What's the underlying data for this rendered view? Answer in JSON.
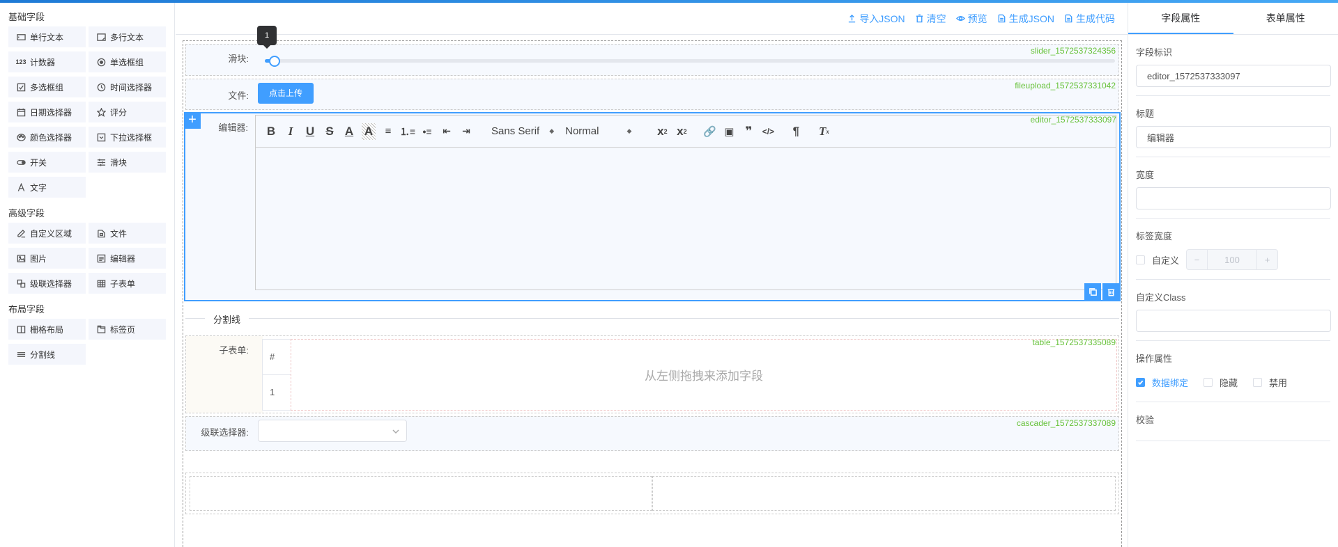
{
  "left_panel": {
    "groups": [
      {
        "title": "基础字段",
        "items": [
          {
            "label": "单行文本",
            "icon": "input-icon"
          },
          {
            "label": "多行文本",
            "icon": "textarea-icon"
          },
          {
            "label": "计数器",
            "icon": "number-icon"
          },
          {
            "label": "单选框组",
            "icon": "radio-icon"
          },
          {
            "label": "多选框组",
            "icon": "checkbox-icon"
          },
          {
            "label": "时间选择器",
            "icon": "clock-icon"
          },
          {
            "label": "日期选择器",
            "icon": "calendar-icon"
          },
          {
            "label": "评分",
            "icon": "star-icon"
          },
          {
            "label": "颜色选择器",
            "icon": "palette-icon"
          },
          {
            "label": "下拉选择框",
            "icon": "select-icon"
          },
          {
            "label": "开关",
            "icon": "switch-icon"
          },
          {
            "label": "滑块",
            "icon": "slider-icon"
          },
          {
            "label": "文字",
            "icon": "text-icon"
          }
        ]
      },
      {
        "title": "高级字段",
        "items": [
          {
            "label": "自定义区域",
            "icon": "pen-icon"
          },
          {
            "label": "文件",
            "icon": "file-icon"
          },
          {
            "label": "图片",
            "icon": "image-icon"
          },
          {
            "label": "编辑器",
            "icon": "editor-icon"
          },
          {
            "label": "级联选择器",
            "icon": "cascader-icon"
          },
          {
            "label": "子表单",
            "icon": "table-icon"
          }
        ]
      },
      {
        "title": "布局字段",
        "items": [
          {
            "label": "栅格布局",
            "icon": "grid-icon"
          },
          {
            "label": "标签页",
            "icon": "tabs-icon"
          },
          {
            "label": "分割线",
            "icon": "divider-icon"
          }
        ]
      }
    ]
  },
  "toolbar": {
    "import_json": "导入JSON",
    "clear": "清空",
    "preview": "预览",
    "gen_json": "生成JSON",
    "gen_code": "生成代码"
  },
  "canvas": {
    "slider": {
      "label": "滑块:",
      "key": "slider_1572537324356",
      "tooltip": "1",
      "value_fraction": 0.008
    },
    "file": {
      "label": "文件:",
      "key": "fileupload_1572537331042",
      "button": "点击上传"
    },
    "editor": {
      "label": "编辑器:",
      "key": "editor_1572537333097",
      "font": "Sans Serif",
      "size": "Normal"
    },
    "divider": {
      "text": "分割线"
    },
    "subtable": {
      "label": "子表单:",
      "key": "table_1572537335089",
      "col_header": "#",
      "row_index": "1",
      "placeholder": "从左侧拖拽来添加字段"
    },
    "cascader": {
      "label": "级联选择器:",
      "key": "cascader_1572537337089",
      "value": ""
    }
  },
  "right_panel": {
    "tabs": [
      "字段属性",
      "表单属性"
    ],
    "active_tab": 0,
    "field_id_label": "字段标识",
    "field_id_value": "editor_1572537333097",
    "title_label": "标题",
    "title_value": "编辑器",
    "width_label": "宽度",
    "width_value": "",
    "label_width_label": "标签宽度",
    "custom_label": "自定义",
    "label_width_value": "100",
    "custom_class_label": "自定义Class",
    "custom_class_value": "",
    "ops_label": "操作属性",
    "ops": [
      {
        "label": "数据绑定",
        "checked": true
      },
      {
        "label": "隐藏",
        "checked": false
      },
      {
        "label": "禁用",
        "checked": false
      }
    ],
    "validate_label": "校验"
  },
  "colors": {
    "accent": "#409eff",
    "key_green": "#67c23a",
    "topbar": "#1e7ad6"
  }
}
